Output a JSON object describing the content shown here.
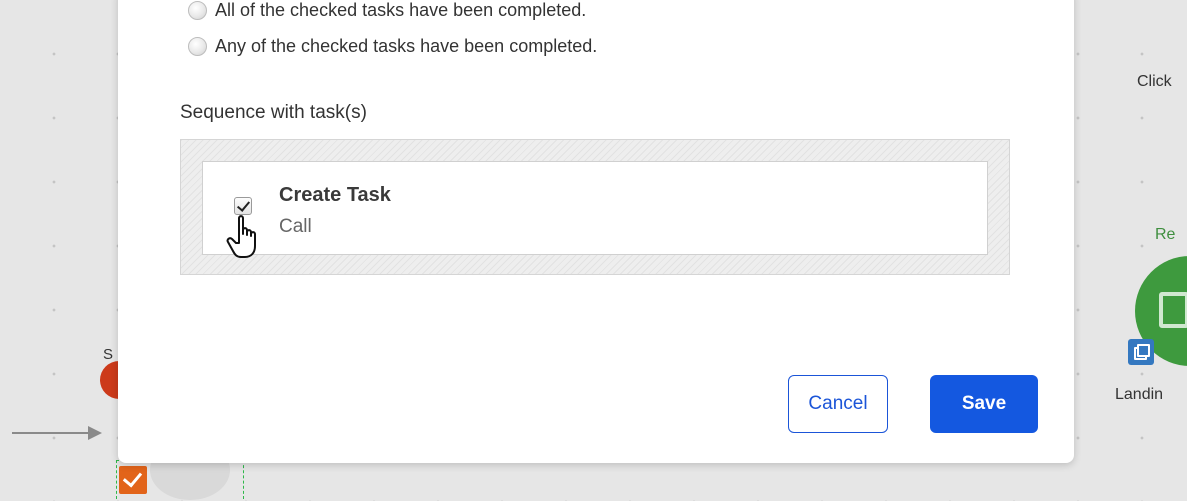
{
  "background": {
    "right_labels": {
      "click": "Click",
      "rea": "Re",
      "landing": "Landin"
    },
    "left_label": "S"
  },
  "modal": {
    "radio_options": [
      "All of the checked tasks have been completed.",
      "Any of the checked tasks have been completed."
    ],
    "section_label": "Sequence with task(s)",
    "task": {
      "title": "Create Task",
      "subtitle": "Call",
      "checked": true
    },
    "buttons": {
      "cancel": "Cancel",
      "save": "Save"
    }
  },
  "colors": {
    "primary": "#1458e0",
    "canvas": "#e6e6e6",
    "green": "#3e9a3e",
    "orange": "#e2641a"
  }
}
